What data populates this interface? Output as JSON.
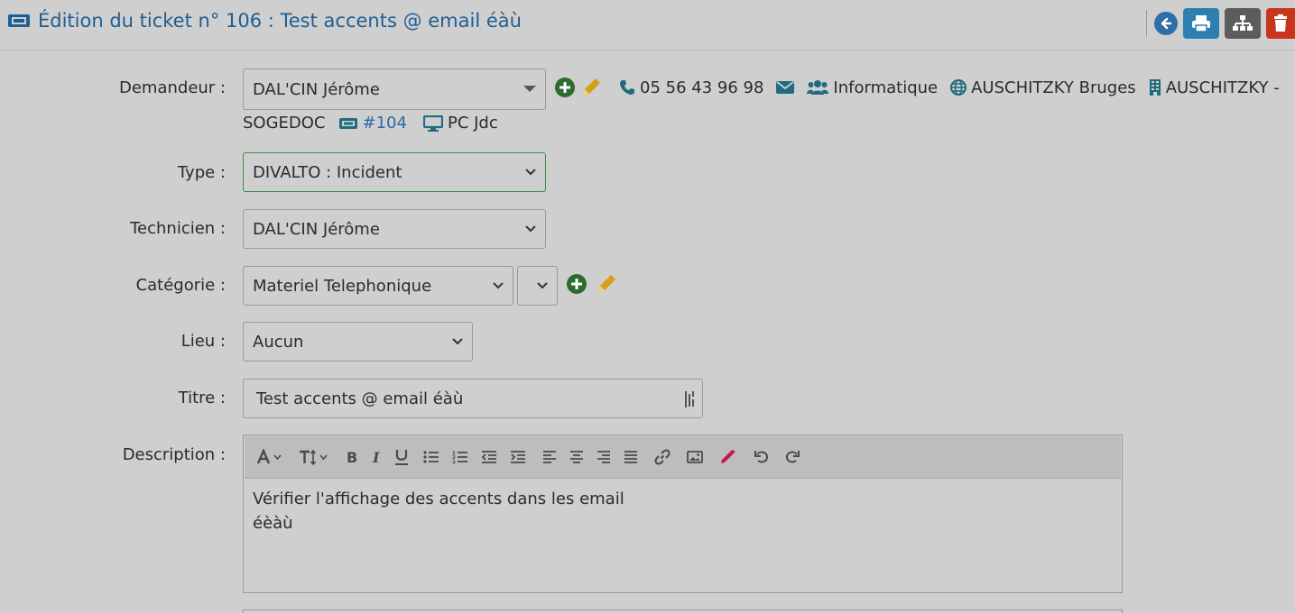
{
  "header": {
    "title": "Édition du ticket n° 106 : Test accents @ email éàù"
  },
  "form": {
    "demandeur": {
      "label": "Demandeur :",
      "value": "DAL'CIN Jérôme",
      "phone": "05 56 43 96 98",
      "group": "Informatique",
      "site": "AUSCHITZKY Bruges",
      "company_part1": "AUSCHITZKY -",
      "company_part2": "SOGEDOC",
      "ticket_ref": "#104",
      "computer": "PC Jdc"
    },
    "type": {
      "label": "Type :",
      "value": "DIVALTO : Incident"
    },
    "technicien": {
      "label": "Technicien :",
      "value": "DAL'CIN Jérôme"
    },
    "categorie": {
      "label": "Catégorie :",
      "value": "Materiel Telephonique",
      "sub_value": ""
    },
    "lieu": {
      "label": "Lieu :",
      "value": "Aucun"
    },
    "titre": {
      "label": "Titre :",
      "value": "Test accents @ email éàù"
    },
    "description": {
      "label": "Description :",
      "line1": "Vérifier l'affichage des accents dans les email",
      "line2": "éèàù"
    }
  },
  "colors": {
    "title_blue": "#1f5e93",
    "add_green": "#2e6b2e",
    "edit_yellow": "#d4a017",
    "teal": "#1f6b80",
    "print_blue": "#2e7fb1",
    "trash_red": "#c9351c"
  },
  "icons": [
    "ticket-icon",
    "back-icon",
    "print-icon",
    "tree-icon",
    "trash-icon",
    "plus-circle-icon",
    "pencil-icon",
    "phone-icon",
    "envelope-icon",
    "users-icon",
    "globe-icon",
    "building-icon",
    "computer-icon",
    "font-icon",
    "text-height-icon",
    "bold-icon",
    "italic-icon",
    "underline-icon",
    "list-ul-icon",
    "list-ol-icon",
    "outdent-icon",
    "indent-icon",
    "align-left-icon",
    "align-center-icon",
    "align-right-icon",
    "align-justify-icon",
    "link-icon",
    "image-icon",
    "eyedropper-icon",
    "undo-icon",
    "redo-icon"
  ]
}
